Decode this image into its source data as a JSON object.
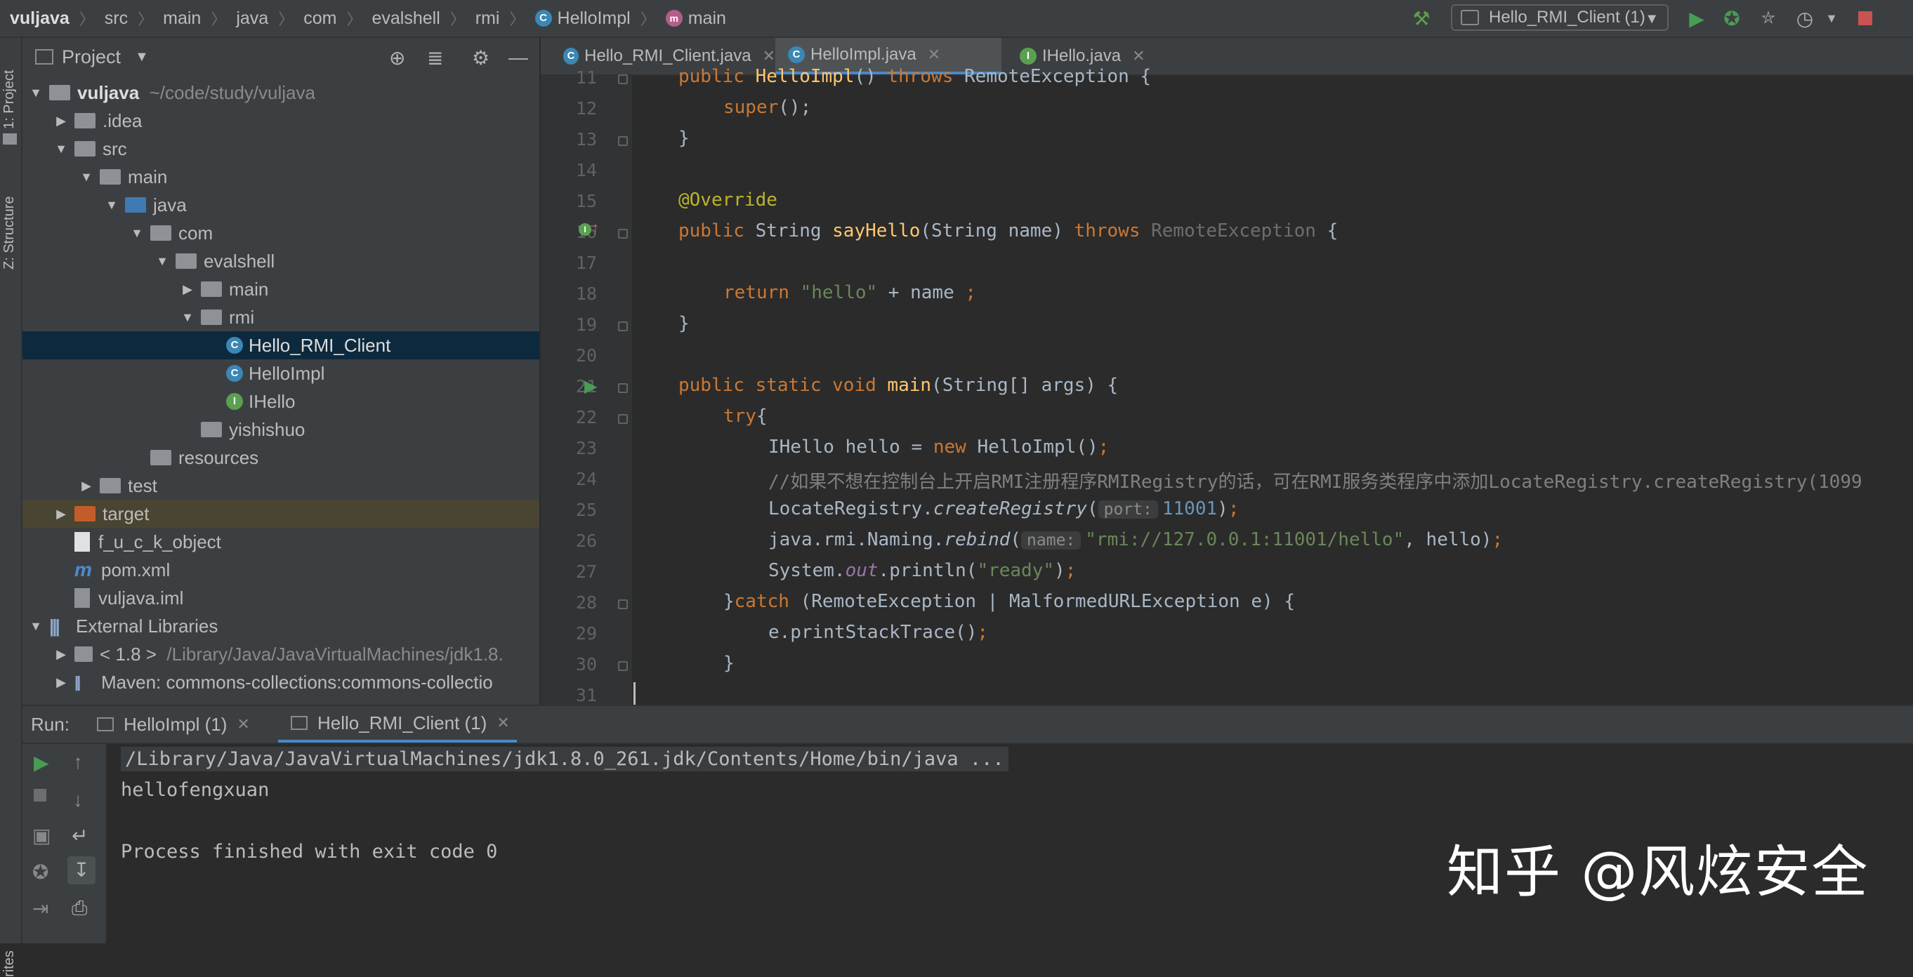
{
  "breadcrumb": [
    "vuljava",
    "src",
    "main",
    "java",
    "com",
    "evalshell",
    "rmi",
    "HelloImpl",
    "main"
  ],
  "run_config": "Hello_RMI_Client (1)",
  "left_strip": {
    "project_tab": "1: Project",
    "structure_tab": "Z: Structure",
    "favorites_tab": "rites"
  },
  "project_panel": {
    "title": "Project",
    "tree": [
      {
        "name": "vuljava",
        "extra": "~/code/study/vuljava"
      },
      {
        "name": ".idea"
      },
      {
        "name": "src"
      },
      {
        "name": "main"
      },
      {
        "name": "java"
      },
      {
        "name": "com"
      },
      {
        "name": "evalshell"
      },
      {
        "name": "main"
      },
      {
        "name": "rmi"
      },
      {
        "name": "Hello_RMI_Client"
      },
      {
        "name": "HelloImpl"
      },
      {
        "name": "IHello"
      },
      {
        "name": "yishishuo"
      },
      {
        "name": "resources"
      },
      {
        "name": "test"
      },
      {
        "name": "target"
      },
      {
        "name": "f_u_c_k_object"
      },
      {
        "name": "pom.xml"
      },
      {
        "name": "vuljava.iml"
      },
      {
        "name": "External Libraries"
      },
      {
        "name": "< 1.8 >",
        "extra": "/Library/Java/JavaVirtualMachines/jdk1.8."
      },
      {
        "name": "Maven: commons-collections:commons-collectio"
      }
    ]
  },
  "editor_tabs": [
    "Hello_RMI_Client.java",
    "HelloImpl.java",
    "IHello.java"
  ],
  "code": {
    "line_numbers": [
      "11",
      "12",
      "13",
      "14",
      "15",
      "16",
      "17",
      "18",
      "19",
      "20",
      "21",
      "22",
      "23",
      "24",
      "25",
      "26",
      "27",
      "28",
      "29",
      "30",
      "31"
    ],
    "l11_a": "public ",
    "l11_b": "HelloImpl",
    "l11_c": "() ",
    "l11_d": "throws ",
    "l11_e": "RemoteException {",
    "l12_a": "super",
    "l12_b": "();",
    "l13": "}",
    "l15": "@Override",
    "l16_a": "public ",
    "l16_b": "String ",
    "l16_c": "sayHello",
    "l16_d": "(String name) ",
    "l16_e": "throws ",
    "l16_f": "RemoteException",
    "l16_g": " {",
    "l18_a": "return ",
    "l18_b": "\"hello\"",
    "l18_c": " + name ",
    "l18_d": ";",
    "l19": "}",
    "l21_a": "public static void ",
    "l21_b": "main",
    "l21_c": "(String[] args) {",
    "l22_a": "try",
    "l22_b": "{",
    "l23_a": "IHello hello = ",
    "l23_b": "new ",
    "l23_c": "HelloImpl()",
    "l23_d": ";",
    "l24": "//如果不想在控制台上开启RMI注册程序RMIRegistry的话，可在RMI服务类程序中添加LocateRegistry.createRegistry(1099",
    "l25_a": "LocateRegistry.",
    "l25_b": "createRegistry",
    "l25_c": "(",
    "l25_hint": "port:",
    "l25_d": "11001",
    "l25_e": ")",
    "l25_f": ";",
    "l26_a": "java.rmi.Naming.",
    "l26_b": "rebind",
    "l26_c": "(",
    "l26_hint": "name:",
    "l26_d": "\"rmi://127.0.0.1:11001/hello\"",
    "l26_e": ", hello)",
    "l26_f": ";",
    "l27_a": "System.",
    "l27_b": "out",
    "l27_c": ".println(",
    "l27_d": "\"ready\"",
    "l27_e": ")",
    "l27_f": ";",
    "l28_a": "}",
    "l28_b": "catch ",
    "l28_c": "(RemoteException | MalformedURLException e) {",
    "l29_a": "e.printStackTrace()",
    "l29_b": ";",
    "l30": "}"
  },
  "run_panel": {
    "label": "Run:",
    "tabs": [
      "HelloImpl (1)",
      "Hello_RMI_Client (1)"
    ],
    "console": [
      "/Library/Java/JavaVirtualMachines/jdk1.8.0_261.jdk/Contents/Home/bin/java ...",
      "hellofengxuan",
      "",
      "Process finished with exit code 0"
    ]
  },
  "watermark": "知乎 @风炫安全",
  "colors": {
    "keyword": "#cc7832",
    "string": "#6a8759",
    "annotation": "#bbb529",
    "function": "#ffc66d",
    "comment": "#808080",
    "number": "#6897bb",
    "selection": "#0d293e",
    "accent": "#4a88c7"
  }
}
